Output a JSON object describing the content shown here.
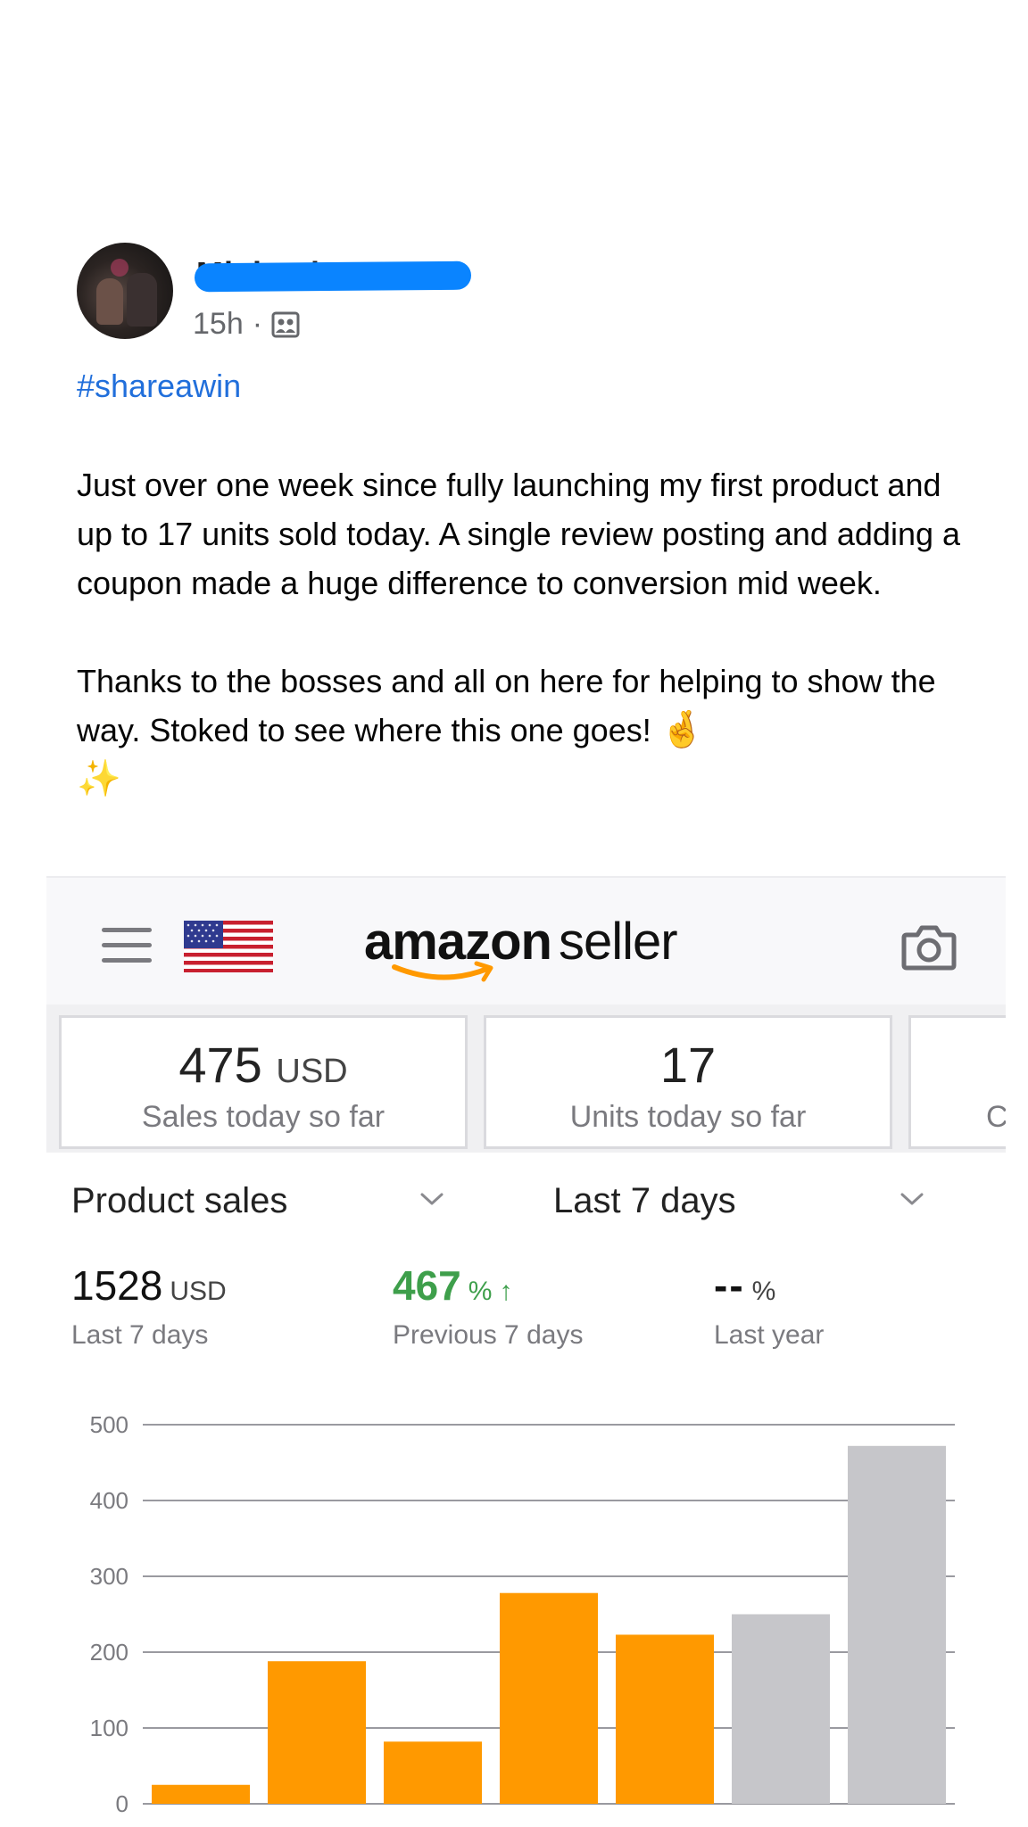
{
  "post": {
    "author_name": "Michael H",
    "time": "15h",
    "separator": "·",
    "audience_icon": "group-icon",
    "hashtag": "#shareawin",
    "paragraph1": "Just over one week since fully launching my first product and up to 17 units sold today. A single review posting and adding a coupon made a huge difference to conversion mid week.",
    "paragraph2_text": "Thanks to the bosses and all on here for helping to show the way. Stoked to see where this one goes!",
    "emoji1": "🤞",
    "emoji2": "✨"
  },
  "app": {
    "brand_part1": "amazon",
    "brand_part2": "seller",
    "menu_icon": "hamburger-icon",
    "flag_icon": "us-flag-icon",
    "camera_icon": "camera-icon",
    "accent_color": "#ff9900"
  },
  "kpis": [
    {
      "value": "475",
      "unit": "USD",
      "label": "Sales today so far"
    },
    {
      "value": "17",
      "unit": "",
      "label": "Units today so far"
    },
    {
      "value": "",
      "unit": "",
      "label": "C"
    }
  ],
  "filters": {
    "metric": "Product sales",
    "period": "Last 7 days"
  },
  "stats": [
    {
      "value": "1528",
      "unit": "USD",
      "label": "Last 7 days"
    },
    {
      "value": "467",
      "unit": "%",
      "arrow": "↑",
      "label": "Previous 7 days"
    },
    {
      "value": "--",
      "unit": "%",
      "label": "Last year"
    }
  ],
  "chart_data": {
    "type": "bar",
    "y_ticks": [
      "500",
      "400",
      "300",
      "200",
      "100",
      "0"
    ],
    "ylim": [
      0,
      500
    ],
    "values": [
      25,
      188,
      82,
      278,
      223,
      250,
      472
    ],
    "colors": [
      "#ff9900",
      "#ff9900",
      "#ff9900",
      "#ff9900",
      "#ff9900",
      "#c6c6ca",
      "#c6c6ca"
    ],
    "grid": true
  }
}
